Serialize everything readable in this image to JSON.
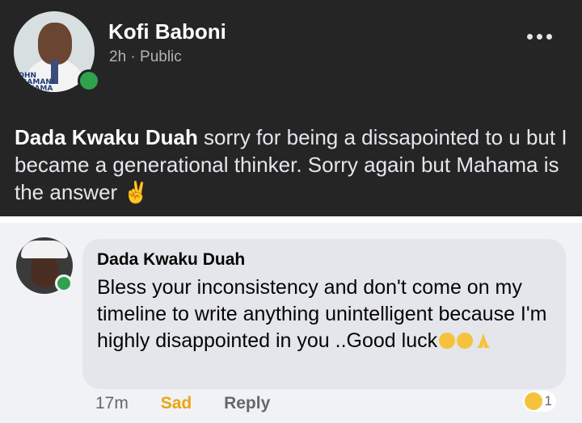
{
  "post": {
    "author": "Kofi Baboni",
    "time": "2h",
    "separator": "·",
    "visibility": "Public",
    "avatar_badge_lines": [
      "JOHN",
      "DRAMANI",
      "MAHAMA"
    ],
    "mention": "Dada Kwaku Duah",
    "text": " sorry for being a dissapointed to u but I became a generational thinker. Sorry again but Mahama is the answer ",
    "emoji": "✌"
  },
  "comment": {
    "author": "Dada Kwaku Duah",
    "text": "Bless your inconsistency and don't come on my timeline to write anything unintelligent because I'm highly disappointed in you ..Good luck",
    "time": "17m",
    "reaction_label": "Sad",
    "reply_label": "Reply",
    "reaction_count": "1"
  },
  "colors": {
    "post_bg": "#252525",
    "online": "#31a24c",
    "sad_reaction": "#e9a510",
    "bubble": "#e4e6eb"
  },
  "icons": [
    "more-icon",
    "online-dot-icon",
    "victory-hand-icon",
    "worried-face-icon",
    "neutral-face-icon",
    "folded-hands-icon",
    "sad-reaction-icon"
  ]
}
